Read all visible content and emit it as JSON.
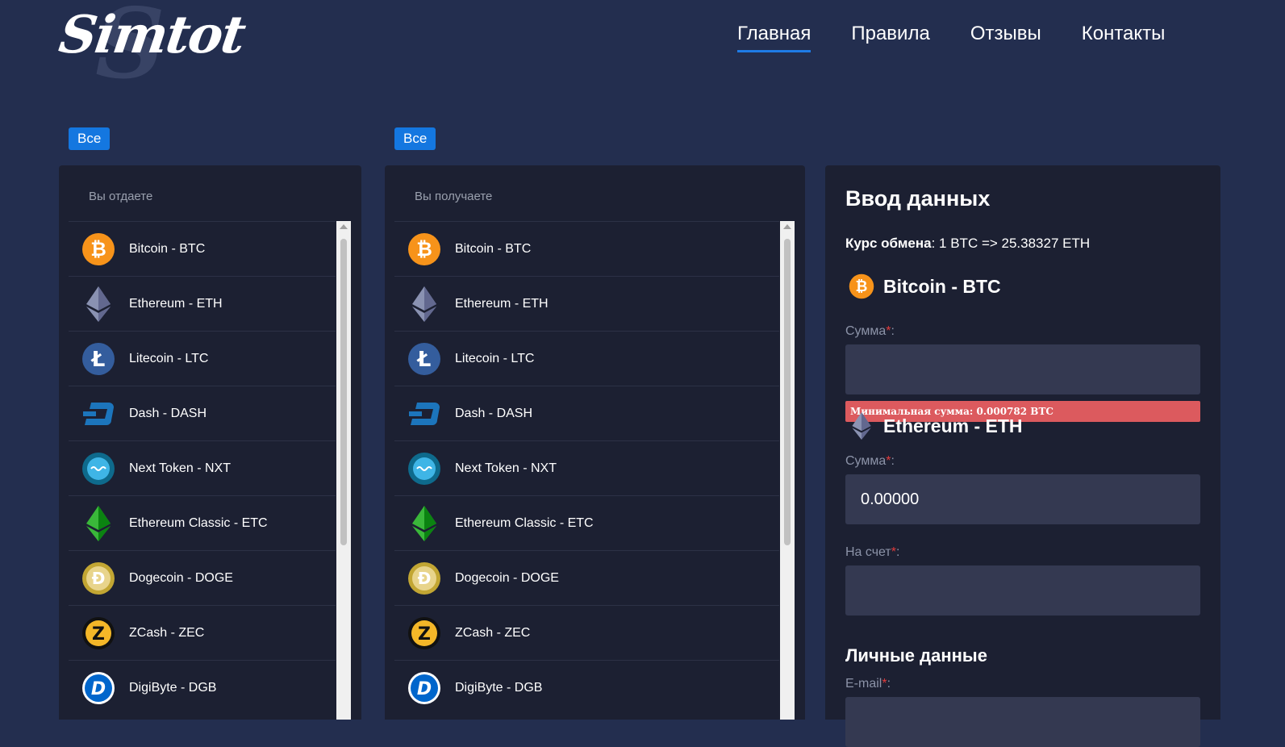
{
  "logo": {
    "text": "Simtot",
    "ghost": "S"
  },
  "nav": [
    {
      "label": "Главная",
      "active": true
    },
    {
      "label": "Правила",
      "active": false
    },
    {
      "label": "Отзывы",
      "active": false
    },
    {
      "label": "Контакты",
      "active": false
    }
  ],
  "filters": {
    "give_all": "Все",
    "get_all": "Все"
  },
  "give": {
    "title": "Вы отдаете",
    "items": [
      {
        "label": "Bitcoin - BTC",
        "icon": "bitcoin-icon"
      },
      {
        "label": "Ethereum - ETH",
        "icon": "ethereum-icon"
      },
      {
        "label": "Litecoin - LTC",
        "icon": "litecoin-icon"
      },
      {
        "label": "Dash - DASH",
        "icon": "dash-icon"
      },
      {
        "label": "Next Token - NXT",
        "icon": "nxt-icon"
      },
      {
        "label": "Ethereum Classic - ETC",
        "icon": "ethereum-classic-icon"
      },
      {
        "label": "Dogecoin - DOGE",
        "icon": "dogecoin-icon"
      },
      {
        "label": "ZCash - ZEC",
        "icon": "zcash-icon"
      },
      {
        "label": "DigiByte - DGB",
        "icon": "digibyte-icon"
      }
    ]
  },
  "get": {
    "title": "Вы получаете",
    "items": [
      {
        "label": "Bitcoin - BTC",
        "icon": "bitcoin-icon"
      },
      {
        "label": "Ethereum - ETH",
        "icon": "ethereum-icon"
      },
      {
        "label": "Litecoin - LTC",
        "icon": "litecoin-icon"
      },
      {
        "label": "Dash - DASH",
        "icon": "dash-icon"
      },
      {
        "label": "Next Token - NXT",
        "icon": "nxt-icon"
      },
      {
        "label": "Ethereum Classic - ETC",
        "icon": "ethereum-classic-icon"
      },
      {
        "label": "Dogecoin - DOGE",
        "icon": "dogecoin-icon"
      },
      {
        "label": "ZCash - ZEC",
        "icon": "zcash-icon"
      },
      {
        "label": "DigiByte - DGB",
        "icon": "digibyte-icon"
      }
    ]
  },
  "form": {
    "title": "Ввод данных",
    "rate_label": "Курс обмена",
    "rate_value": ": 1 BTC => 25.38327 ETH",
    "give_currency": "Bitcoin - BTC",
    "amount_label": "Сумма",
    "amount_value": "",
    "error": "Минимальная сумма: 0.000782 BTC",
    "get_currency": "Ethereum - ETH",
    "get_amount_label": "Сумма",
    "get_amount_value": "0.00000",
    "account_label": "На счет",
    "account_value": "",
    "personal_title": "Личные данные",
    "email_label": "E-mail",
    "required_mark": "*",
    "colon": ":"
  },
  "colors": {
    "accent": "#1477e0",
    "error": "#dc5a5e",
    "background": "#232e4f",
    "panel": "#1c2032"
  }
}
